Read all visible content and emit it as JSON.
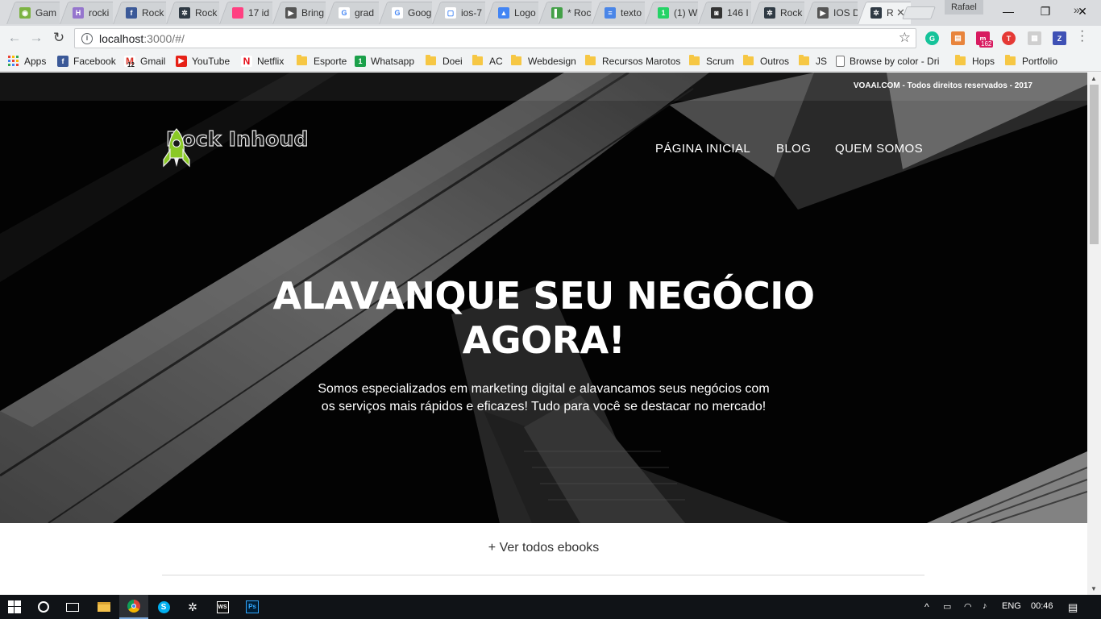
{
  "browser": {
    "tabs": [
      {
        "label": "Gam",
        "color": "#7cb342",
        "glyph": "◉"
      },
      {
        "label": "rocki",
        "color": "#9575cd",
        "glyph": "H"
      },
      {
        "label": "Rock",
        "color": "#3b5998",
        "glyph": "f"
      },
      {
        "label": "Rock",
        "color": "#2f3a44",
        "glyph": "✲"
      },
      {
        "label": "17 id",
        "color": "#ff4081",
        "glyph": ""
      },
      {
        "label": "Bring",
        "color": "#555",
        "glyph": "▶"
      },
      {
        "label": "grad",
        "color": "#ffffff",
        "glyph": "G"
      },
      {
        "label": "Goog",
        "color": "#ffffff",
        "glyph": "G"
      },
      {
        "label": "ios-7",
        "color": "#ffffff",
        "glyph": "▢"
      },
      {
        "label": "Logo",
        "color": "#4285f4",
        "glyph": "▲"
      },
      {
        "label": "* Roc",
        "color": "#43a047",
        "glyph": "▌"
      },
      {
        "label": "texto",
        "color": "#4a86e8",
        "glyph": "≡"
      },
      {
        "label": "(1) W",
        "color": "#25d366",
        "glyph": "1"
      },
      {
        "label": "146 I",
        "color": "#333",
        "glyph": "◙"
      },
      {
        "label": "Rock",
        "color": "#2f3a44",
        "glyph": "✲"
      },
      {
        "label": "IOS D",
        "color": "#555",
        "glyph": "▶"
      },
      {
        "label": "R",
        "color": "#2f3a44",
        "glyph": "✲",
        "active": true
      }
    ],
    "profile_name": "Rafael",
    "url_host": "localhost",
    "url_path": ":3000/#/",
    "bookmarks": [
      {
        "label": "Apps",
        "kind": "apps"
      },
      {
        "label": "Facebook",
        "kind": "icon",
        "color": "#3b5998",
        "glyph": "f"
      },
      {
        "label": "Gmail",
        "kind": "icon",
        "color": "#ffffff",
        "glyph": "M"
      },
      {
        "label": "YouTube",
        "kind": "icon",
        "color": "#e62117",
        "glyph": "▶"
      },
      {
        "label": "Netflix",
        "kind": "icon",
        "color": "#ffffff",
        "glyph": "N"
      },
      {
        "label": "Esporte",
        "kind": "folder"
      },
      {
        "label": "Whatsapp",
        "kind": "icon",
        "color": "#1ba04a",
        "glyph": "1"
      },
      {
        "label": "Doei",
        "kind": "folder"
      },
      {
        "label": "AC",
        "kind": "folder"
      },
      {
        "label": "Webdesign",
        "kind": "folder"
      },
      {
        "label": "Recursos Marotos",
        "kind": "folder"
      },
      {
        "label": "Scrum",
        "kind": "folder"
      },
      {
        "label": "Outros",
        "kind": "folder"
      },
      {
        "label": "JS",
        "kind": "folder"
      },
      {
        "label": "Browse by color - Dri",
        "kind": "page"
      },
      {
        "label": "Hops",
        "kind": "folder"
      },
      {
        "label": "Portfolio",
        "kind": "folder"
      }
    ],
    "gmail_badge": "12",
    "ext_badge": "162"
  },
  "page": {
    "copyright": "VOAAI.COM - Todos direitos reservados - 2017",
    "brand": "Rock Inhoud",
    "nav": [
      "PÁGINA INICIAL",
      "BLOG",
      "QUEM SOMOS"
    ],
    "headline_line1": "ALAVANQUE SEU NEGÓCIO",
    "headline_line2": "AGORA!",
    "subtitle": "Somos especializados em marketing digital e alavancamos seus negócios com os serviços mais rápidos e eficazes! Tudo para você se destacar no mercado!",
    "more_link": "+ Ver todos ebooks",
    "accent": "#8ac926"
  },
  "taskbar": {
    "language": "ENG",
    "time": "00:46"
  }
}
